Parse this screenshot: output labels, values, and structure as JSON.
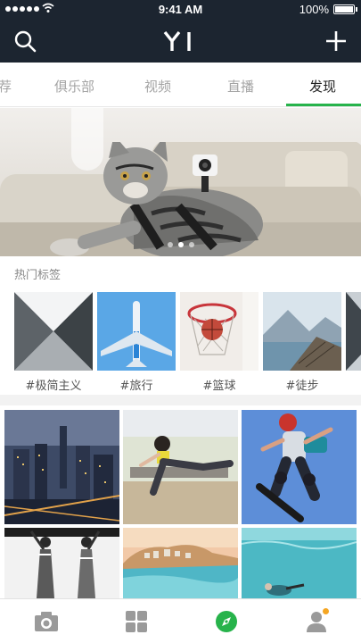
{
  "status_bar": {
    "time": "9:41 AM",
    "battery": "100%",
    "icons": [
      "signal-dots-icon",
      "wifi-icon",
      "battery-icon"
    ]
  },
  "header": {
    "logo_text": "YI",
    "left_icon": "search-icon",
    "right_icon": "add-icon"
  },
  "tabs": [
    {
      "label": "推荐",
      "active": false
    },
    {
      "label": "俱乐部",
      "active": false
    },
    {
      "label": "视频",
      "active": false
    },
    {
      "label": "直播",
      "active": false
    },
    {
      "label": "发现",
      "active": true
    }
  ],
  "colors": {
    "header_bg": "#1c2530",
    "accent": "#27b34b",
    "badge": "#f5a623"
  },
  "banner": {
    "description_icon": "cat-with-action-camera",
    "page_count": 3,
    "active_page": 2
  },
  "hot_tags": {
    "title": "热门标签",
    "items": [
      {
        "label": "#极简主义"
      },
      {
        "label": "#旅行"
      },
      {
        "label": "#篮球"
      },
      {
        "label": "#徒步"
      }
    ]
  },
  "bottom_nav": [
    {
      "name": "camera",
      "icon": "camera-icon",
      "active": false
    },
    {
      "name": "grid",
      "icon": "grid-icon",
      "active": false
    },
    {
      "name": "discover",
      "icon": "compass-icon",
      "active": true
    },
    {
      "name": "profile",
      "icon": "user-icon",
      "active": false,
      "badge": true
    }
  ]
}
